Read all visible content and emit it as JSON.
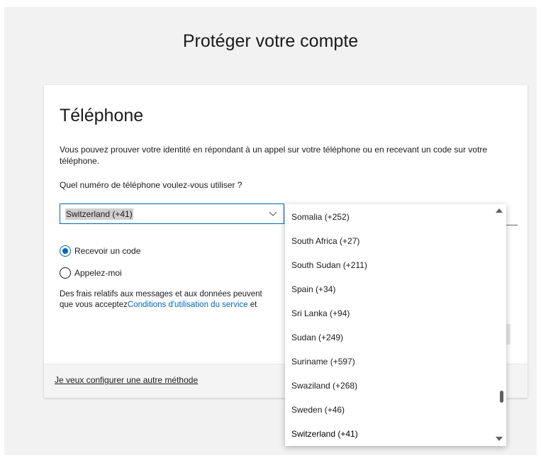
{
  "page": {
    "title": "Protéger votre compte"
  },
  "card": {
    "heading": "Téléphone",
    "description": "Vous pouvez prouver votre identité en répondant à un appel sur votre téléphone ou en recevant un code sur votre téléphone.",
    "question": "Quel numéro de téléphone voulez-vous utiliser ?",
    "country_select": {
      "selected": "Switzerland (+41)"
    },
    "radios": [
      {
        "label": "Recevoir un code",
        "checked": true
      },
      {
        "label": "Appelez-moi",
        "checked": false
      }
    ],
    "fees": {
      "line1": "Des frais relatifs aux messages et aux données peuvent",
      "line2_prefix": "que vous acceptez",
      "terms_link": "Conditions d'utilisation du service",
      "line2_suffix": " et"
    },
    "footer_link": "Je veux configurer une autre méthode"
  },
  "dropdown": {
    "options": [
      "Somalia (+252)",
      "South Africa (+27)",
      "South Sudan (+211)",
      "Spain (+34)",
      "Sri Lanka (+94)",
      "Sudan (+249)",
      "Suriname (+597)",
      "Swaziland (+268)",
      "Sweden (+46)",
      "Switzerland (+41)"
    ],
    "selected_index": 9
  },
  "colors": {
    "accent": "#0067b8",
    "text": "#1b1b1b",
    "background": "#f2f2f2"
  },
  "icons": [
    "chevron-down-icon",
    "scroll-up-arrow-icon",
    "scroll-down-arrow-icon"
  ]
}
